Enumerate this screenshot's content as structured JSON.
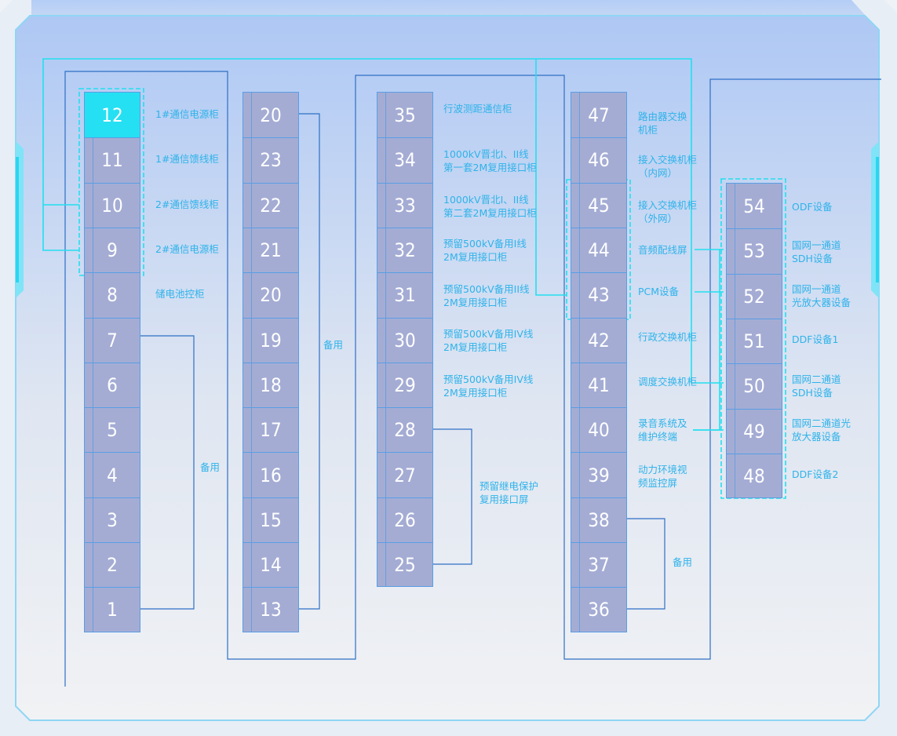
{
  "colors": {
    "cell_fill": "#a4acd4",
    "cell_active": "#25e0f2",
    "accent_cyan": "#22dff0",
    "line_blue": "#2f6fc5",
    "label_text": "#2fb3ea"
  },
  "columns": [
    {
      "id": "c1",
      "cells": [
        "12",
        "11",
        "10",
        "9",
        "8",
        "7",
        "6",
        "5",
        "4",
        "3",
        "2",
        "1"
      ],
      "active": "12"
    },
    {
      "id": "c2",
      "cells": [
        "20",
        "23",
        "22",
        "21",
        "20",
        "19",
        "18",
        "17",
        "16",
        "15",
        "14",
        "13"
      ]
    },
    {
      "id": "c3",
      "cells": [
        "35",
        "34",
        "33",
        "32",
        "31",
        "30",
        "29",
        "28",
        "27",
        "26",
        "25"
      ]
    },
    {
      "id": "c4",
      "cells": [
        "47",
        "46",
        "45",
        "44",
        "43",
        "42",
        "41",
        "40",
        "39",
        "38",
        "37",
        "36"
      ]
    },
    {
      "id": "c5",
      "cells": [
        "54",
        "53",
        "52",
        "51",
        "50",
        "49",
        "48"
      ]
    }
  ],
  "labels": {
    "c1": [
      "1#通信电源柜",
      "1#通信馈线柜",
      "2#通信馈线柜",
      "2#通信电源柜",
      "储电池控柜"
    ],
    "c1_spare": "备用",
    "c2_spare": "备用",
    "c3": [
      "行波测距通信柜",
      "1000kV晋北I、II线\n第一套2M复用接口柜",
      "1000kV晋北I、II线\n第二套2M复用接口柜",
      "预留500kV备用I线\n2M复用接口柜",
      "预留500kV备用II线\n2M复用接口柜",
      "预留500kV备用IV线\n2M复用接口柜",
      "预留500kV备用IV线\n2M复用接口柜"
    ],
    "c3_group": "预留继电保护\n复用接口屏",
    "c4": [
      "路由器交换\n机柜",
      "接入交换机柜\n（内网）",
      "接入交换机柜\n（外网）",
      "音频配线屏",
      "PCM设备",
      "行政交换机柜",
      "调度交换机柜",
      "录音系统及\n维护终端",
      "动力环境视\n频监控屏"
    ],
    "c4_spare": "备用",
    "c5": [
      "ODF设备",
      "国网一通道\nSDH设备",
      "国网一通道\n光放大器设备",
      "DDF设备1",
      "国网二通道\nSDH设备",
      "国网二通道光\n放大器设备",
      "DDF设备2"
    ]
  }
}
